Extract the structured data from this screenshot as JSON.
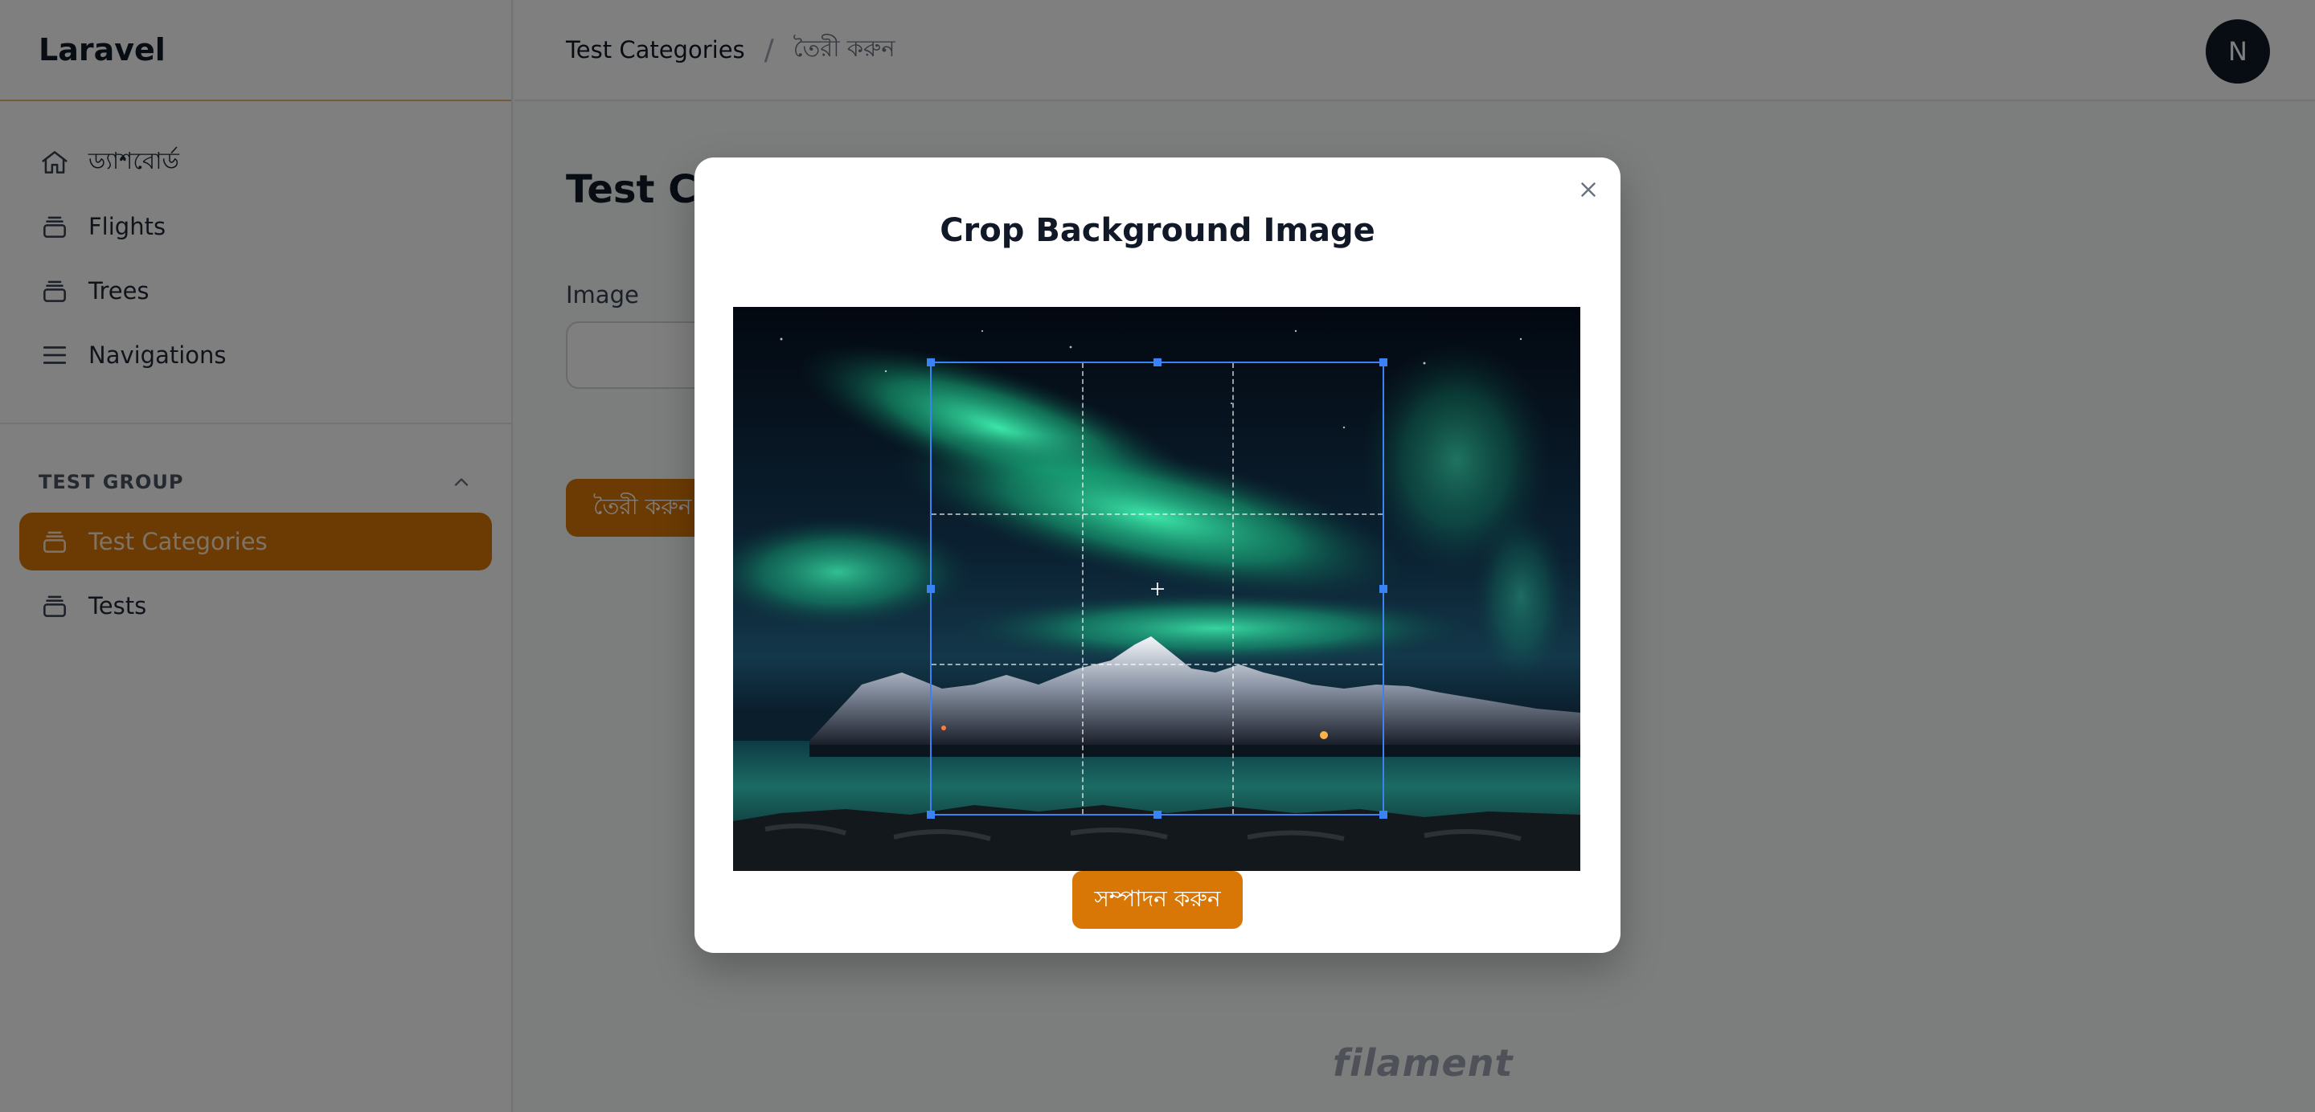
{
  "app": {
    "brand": "Laravel"
  },
  "sidebar": {
    "items": [
      {
        "label": "ড্যাশবোর্ড",
        "icon": "home-icon"
      },
      {
        "label": "Flights",
        "icon": "collection-icon"
      },
      {
        "label": "Trees",
        "icon": "collection-icon"
      },
      {
        "label": "Navigations",
        "icon": "menu-icon"
      }
    ],
    "group": {
      "label": "TEST GROUP",
      "icon": "chevron-up-icon",
      "items": [
        {
          "label": "Test Categories",
          "icon": "collection-icon",
          "active": true
        },
        {
          "label": "Tests",
          "icon": "collection-icon"
        }
      ]
    }
  },
  "topbar": {
    "breadcrumb": [
      "Test Categories",
      "তৈরী করুন"
    ],
    "avatar_initial": "N"
  },
  "main": {
    "title": "Test Ca",
    "field_label": "Image",
    "create_button": "তৈরী করুন",
    "footer_logo": "filament"
  },
  "modal": {
    "title": "Crop Background Image",
    "close_icon": "close-icon",
    "submit_button": "সম্পাদন করুন"
  },
  "colors": {
    "accent": "#d97706",
    "crop_border": "#3b82f6",
    "avatar_bg": "#111827"
  }
}
